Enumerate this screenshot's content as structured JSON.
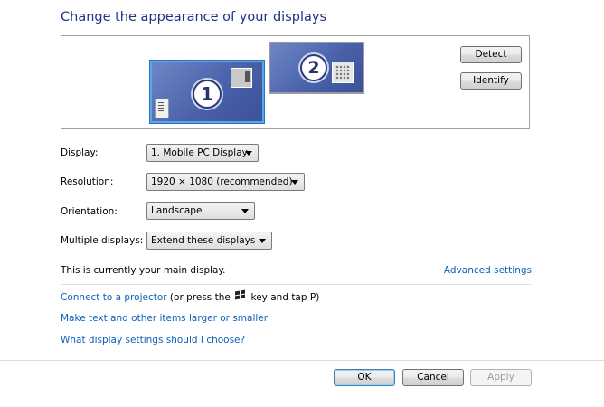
{
  "page_title": "Change the appearance of your displays",
  "preview": {
    "monitor_1_number": "1",
    "monitor_2_number": "2",
    "detect_label": "Detect",
    "identify_label": "Identify"
  },
  "settings": {
    "display": {
      "label": "Display:",
      "value": "1. Mobile PC Display"
    },
    "resolution": {
      "label": "Resolution:",
      "value": "1920 × 1080 (recommended)"
    },
    "orientation": {
      "label": "Orientation:",
      "value": "Landscape"
    },
    "multiple_displays": {
      "label": "Multiple displays:",
      "value": "Extend these displays"
    }
  },
  "main_display_text": "This is currently your main display.",
  "advanced_settings_link": "Advanced settings",
  "links": {
    "projector_link": "Connect to a projector",
    "projector_suffix_1": " (or press the ",
    "projector_suffix_2": " key and tap P)",
    "text_size_link": "Make text and other items larger or smaller",
    "help_link": "What display settings should I choose?"
  },
  "buttons": {
    "ok": "OK",
    "cancel": "Cancel",
    "apply": "Apply"
  },
  "colors": {
    "title": "#1e3287",
    "link": "#0e5fb8",
    "monitor_fill": "#4a62aa"
  },
  "icons": [
    "windows-key-icon",
    "dropdown-arrow-icon"
  ]
}
